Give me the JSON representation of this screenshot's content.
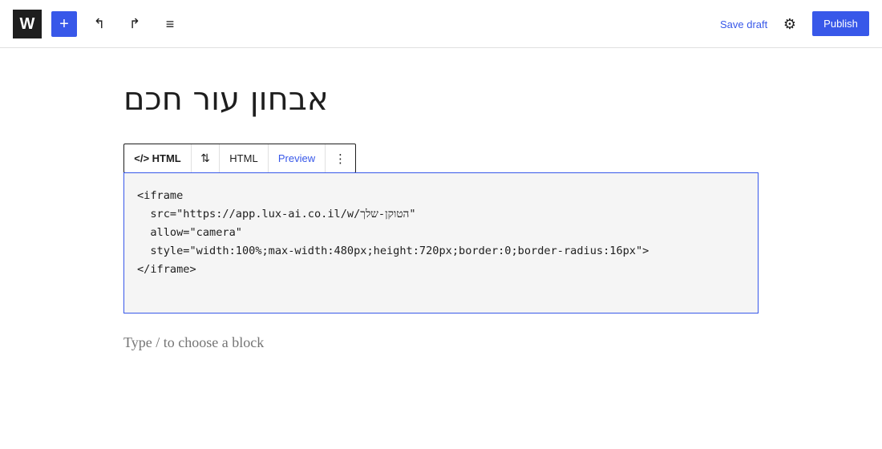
{
  "toolbar": {
    "logo": "W",
    "add_icon": "+",
    "undo_icon": "↰",
    "redo_icon": "↱",
    "list_view_icon": "≡",
    "save_draft": "Save draft",
    "settings_icon": "⚙",
    "publish": "Publish"
  },
  "post": {
    "title": "אבחון עור חכם"
  },
  "block_toolbar": {
    "type_label": "</> HTML",
    "move_icon": "⇅",
    "html_tab": "HTML",
    "preview_tab": "Preview",
    "more_icon": "⋮"
  },
  "code_block": {
    "content": "<iframe\n  src=\"https://app.lux-ai.co.il/w/הטוקן-שלך\"\n  allow=\"camera\"\n  style=\"width:100%;max-width:480px;height:720px;border:0;border-radius:16px\">\n</iframe>"
  },
  "placeholder": "Type / to choose a block",
  "colors": {
    "accent": "#3858e9",
    "dark": "#1e1e1e",
    "code_bg": "#f5f5f5",
    "muted": "#757575"
  }
}
